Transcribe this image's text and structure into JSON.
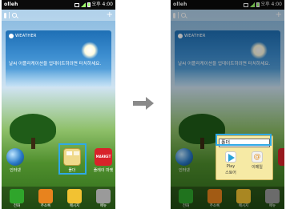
{
  "status_bar": {
    "carrier": "olleh",
    "time": "오후 4:00"
  },
  "weather_widget": {
    "logo_text": "WEATHER",
    "message": "날씨 어플리케이션을 업데이트하려면 터치하세요."
  },
  "home_apps": [
    {
      "label": "인터넷"
    },
    {
      "label": "폴더"
    },
    {
      "label": "플레이 마켓",
      "icon_text": "MARKET"
    }
  ],
  "dock": [
    {
      "label": "전화"
    },
    {
      "label": "주소록"
    },
    {
      "label": "메시지"
    },
    {
      "label": "메뉴"
    }
  ],
  "folder_popup": {
    "name_value": "폴더",
    "apps": [
      {
        "label_line1": "Play",
        "label_line2": "스토어"
      },
      {
        "label": "이메일",
        "icon_glyph": "@"
      }
    ]
  },
  "colors": {
    "highlight": "#2fa9e6",
    "arrow": "#8a8a8a"
  }
}
